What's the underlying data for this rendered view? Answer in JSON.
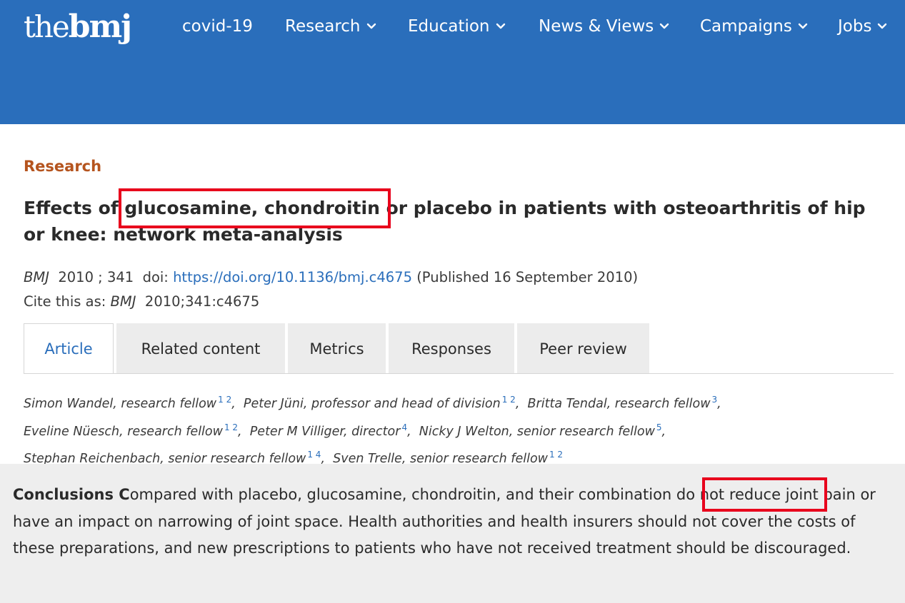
{
  "header": {
    "logo_the": "the",
    "logo_bmj": "bmj",
    "nav": [
      {
        "label": "covid-19",
        "has_dropdown": false
      },
      {
        "label": "Research",
        "has_dropdown": true
      },
      {
        "label": "Education",
        "has_dropdown": true
      },
      {
        "label": "News & Views",
        "has_dropdown": true
      },
      {
        "label": "Campaigns",
        "has_dropdown": true
      },
      {
        "label": "Jobs",
        "has_dropdown": true
      }
    ]
  },
  "colors": {
    "brand_blue": "#2a6ebb",
    "section_orange": "#b5541e",
    "highlight_red": "#e8001c",
    "conclusions_bg": "#eeeeee"
  },
  "article": {
    "section": "Research",
    "title_before": "Effects of ",
    "title_highlight": "glucosamine, chondroitin",
    "title_after": " or placebo in patients with osteoarthritis of hip or knee: network meta-analysis",
    "journal": "BMJ",
    "year_vol": "2010 ; 341",
    "doi_label": "doi:",
    "doi_url": "https://doi.org/10.1136/bmj.c4675",
    "published": "(Published 16 September 2010)",
    "cite_label": "Cite this as:",
    "cite_journal": "BMJ",
    "cite_ref": "2010;341:c4675"
  },
  "tabs": [
    {
      "label": "Article",
      "active": true
    },
    {
      "label": "Related content",
      "active": false
    },
    {
      "label": "Metrics",
      "active": false
    },
    {
      "label": "Responses",
      "active": false
    },
    {
      "label": "Peer review",
      "active": false
    }
  ],
  "authors": [
    {
      "name": "Simon Wandel, research fellow",
      "aff": "1 2"
    },
    {
      "name": "Peter Jüni, professor and head of division",
      "aff": "1 2"
    },
    {
      "name": "Britta Tendal, research fellow",
      "aff": "3"
    },
    {
      "name": "Eveline Nüesch, research fellow",
      "aff": "1 2"
    },
    {
      "name": "Peter M Villiger, director",
      "aff": "4"
    },
    {
      "name": "Nicky J Welton, senior research fellow",
      "aff": "5"
    },
    {
      "name": "Stephan Reichenbach, senior research fellow",
      "aff": "1 4"
    },
    {
      "name": "Sven Trelle, senior research fellow",
      "aff": "1 2"
    }
  ],
  "conclusions": {
    "label": "Conclusions C",
    "text_before": "ompared with placebo, glucosamine, chondroitin, and their combination ",
    "highlight": "do not reduce",
    "text_after": " joint pain or have an impact on narrowing of joint space. Health authorities and health insurers should not cover the costs of these preparations, and new prescriptions to patients who have not received treatment should be discouraged."
  }
}
